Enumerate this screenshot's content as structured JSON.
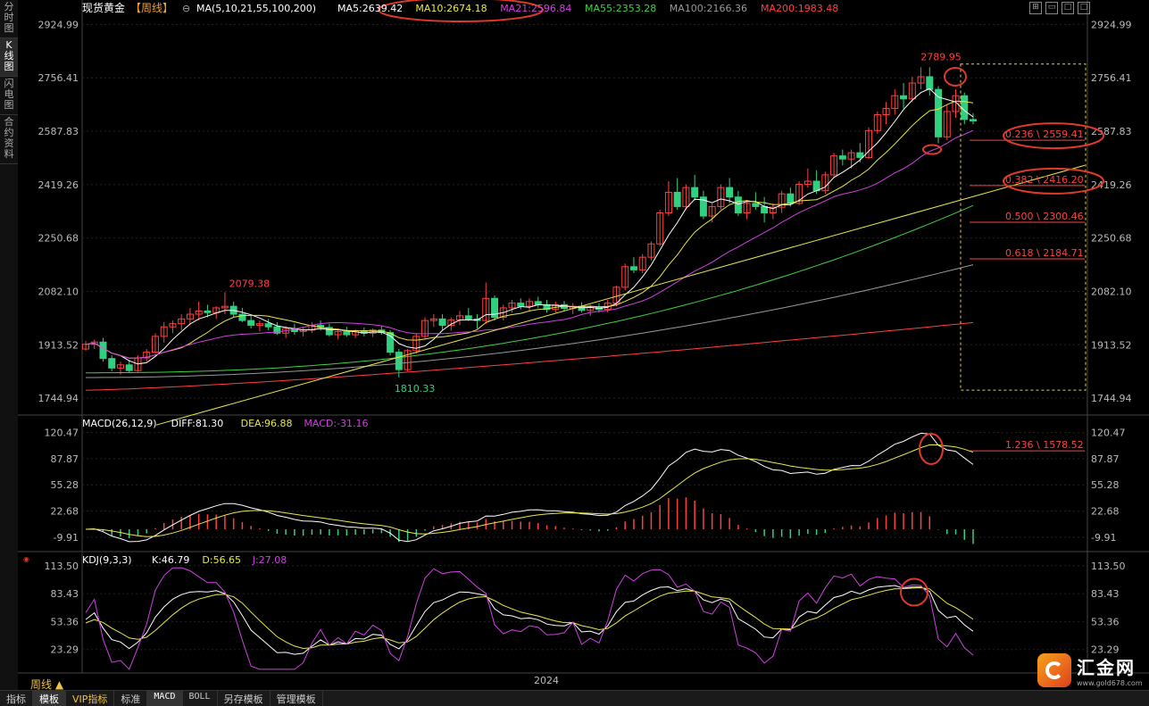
{
  "left_tabs": [
    "分时图",
    "K线图",
    "闪电图",
    "合约资料"
  ],
  "header": {
    "instrument": "现货黄金",
    "period_tag": "【周线】",
    "ma_params": "MA(5,10,21,55,100,200)",
    "ma_values": [
      {
        "label": "MA5:2639.42",
        "color": "#ffffff"
      },
      {
        "label": "MA10:2674.18",
        "color": "#e8e84a"
      },
      {
        "label": "MA21:2596.84",
        "color": "#d040e0"
      },
      {
        "label": "MA55:2353.28",
        "color": "#40d040"
      },
      {
        "label": "MA100:2166.36",
        "color": "#999999"
      },
      {
        "label": "MA200:1983.48",
        "color": "#ff4040"
      }
    ]
  },
  "axis": {
    "main_ticks": [
      "2924.99",
      "2756.41",
      "2587.83",
      "2419.26",
      "2250.68",
      "2082.10",
      "1913.52",
      "1744.94"
    ],
    "macd_ticks": [
      "120.47",
      "87.87",
      "55.28",
      "22.68",
      "-9.91"
    ],
    "kdj_ticks": [
      "113.50",
      "83.43",
      "53.36",
      "23.29"
    ]
  },
  "annotations": {
    "high_label": "2789.95",
    "peak_label": "2079.38",
    "low_label": "1810.33"
  },
  "fib_levels": [
    {
      "label": "0.236 \\ 2559.41",
      "value": 2559.41
    },
    {
      "label": "0.382 \\ 2416.20",
      "value": 2416.2
    },
    {
      "label": "0.500 \\ 2300.46",
      "value": 2300.46
    },
    {
      "label": "0.618 \\ 2184.71",
      "value": 2184.71
    },
    {
      "label": "1.236 \\ 1578.52",
      "value": 1578.52
    }
  ],
  "macd_header": {
    "params": "MACD(26,12,9)",
    "diff": "DIFF:81.30",
    "dea": "DEA:96.88",
    "macd": "MACD:-31.16"
  },
  "kdj_header": {
    "params": "KDJ(9,3,3)",
    "k": "K:46.79",
    "d": "D:56.65",
    "j": "J:27.08"
  },
  "bottom_tabs": [
    "指标",
    "模板",
    "VIP指标",
    "标准",
    "MACD",
    "BOLL",
    "另存模板",
    "管理模板"
  ],
  "period_button": "周线 ▲",
  "year_label": "2024",
  "logo": {
    "name": "汇金网",
    "url": "www.gold678.com"
  },
  "colors": {
    "up": "#ff4040",
    "down": "#30d080",
    "background": "#000000",
    "axis_text": "#bbbbbb",
    "highlight_circle": "#e03a2a",
    "fib_text": "#ff4040"
  },
  "chart_data": {
    "type": "candlestick",
    "period": "weekly",
    "y_range": [
      1700,
      2960
    ],
    "ohlc": [
      [
        1900,
        1925,
        1895,
        1915
      ],
      [
        1915,
        1930,
        1900,
        1922
      ],
      [
        1922,
        1935,
        1860,
        1870
      ],
      [
        1870,
        1880,
        1830,
        1840
      ],
      [
        1840,
        1860,
        1820,
        1850
      ],
      [
        1850,
        1865,
        1825,
        1832
      ],
      [
        1832,
        1880,
        1828,
        1872
      ],
      [
        1872,
        1900,
        1860,
        1890
      ],
      [
        1890,
        1950,
        1885,
        1940
      ],
      [
        1940,
        1985,
        1920,
        1970
      ],
      [
        1970,
        1990,
        1950,
        1980
      ],
      [
        1980,
        2010,
        1960,
        1995
      ],
      [
        1995,
        2030,
        1975,
        2010
      ],
      [
        2010,
        2050,
        1990,
        2020
      ],
      [
        2020,
        2040,
        2000,
        2015
      ],
      [
        2015,
        2035,
        1995,
        2030
      ],
      [
        2030,
        2079.38,
        2010,
        2035
      ],
      [
        2035,
        2050,
        2000,
        2010
      ],
      [
        2010,
        2030,
        1985,
        1990
      ],
      [
        1990,
        2005,
        1965,
        1975
      ],
      [
        1975,
        1990,
        1955,
        1980
      ],
      [
        1980,
        1995,
        1960,
        1970
      ],
      [
        1970,
        1985,
        1945,
        1950
      ],
      [
        1950,
        1972,
        1935,
        1965
      ],
      [
        1965,
        1980,
        1945,
        1955
      ],
      [
        1955,
        1970,
        1940,
        1960
      ],
      [
        1960,
        1985,
        1950,
        1975
      ],
      [
        1975,
        1990,
        1958,
        1968
      ],
      [
        1968,
        1980,
        1940,
        1945
      ],
      [
        1945,
        1965,
        1930,
        1955
      ],
      [
        1955,
        1970,
        1938,
        1945
      ],
      [
        1945,
        1962,
        1935,
        1958
      ],
      [
        1958,
        1968,
        1940,
        1950
      ],
      [
        1950,
        1965,
        1938,
        1960
      ],
      [
        1960,
        1972,
        1945,
        1952
      ],
      [
        1952,
        1960,
        1880,
        1890
      ],
      [
        1890,
        1900,
        1810.33,
        1835
      ],
      [
        1835,
        1900,
        1830,
        1895
      ],
      [
        1895,
        1950,
        1885,
        1940
      ],
      [
        1940,
        2000,
        1930,
        1990
      ],
      [
        1990,
        2010,
        1970,
        1995
      ],
      [
        1995,
        2010,
        1960,
        1975
      ],
      [
        1975,
        2000,
        1958,
        1992
      ],
      [
        1992,
        2020,
        1975,
        2005
      ],
      [
        2005,
        2030,
        1988,
        1995
      ],
      [
        1995,
        2010,
        1965,
        1990
      ],
      [
        1990,
        2110,
        1980,
        2060
      ],
      [
        2060,
        2070,
        1990,
        2000
      ],
      [
        2000,
        2040,
        1990,
        2030
      ],
      [
        2030,
        2055,
        2015,
        2045
      ],
      [
        2045,
        2060,
        2025,
        2035
      ],
      [
        2035,
        2060,
        2020,
        2050
      ],
      [
        2050,
        2065,
        2030,
        2040
      ],
      [
        2040,
        2055,
        2015,
        2025
      ],
      [
        2025,
        2050,
        2015,
        2040
      ],
      [
        2040,
        2052,
        2020,
        2028
      ],
      [
        2028,
        2045,
        2010,
        2035
      ],
      [
        2035,
        2048,
        2015,
        2022
      ],
      [
        2022,
        2040,
        2005,
        2032
      ],
      [
        2032,
        2045,
        2015,
        2025
      ],
      [
        2025,
        2055,
        2015,
        2045
      ],
      [
        2045,
        2100,
        2035,
        2095
      ],
      [
        2095,
        2170,
        2085,
        2160
      ],
      [
        2160,
        2190,
        2140,
        2150
      ],
      [
        2150,
        2200,
        2140,
        2190
      ],
      [
        2190,
        2240,
        2180,
        2232
      ],
      [
        2232,
        2340,
        2225,
        2330
      ],
      [
        2330,
        2430,
        2320,
        2395
      ],
      [
        2395,
        2440,
        2340,
        2350
      ],
      [
        2350,
        2420,
        2340,
        2410
      ],
      [
        2410,
        2450,
        2370,
        2380
      ],
      [
        2380,
        2400,
        2310,
        2320
      ],
      [
        2320,
        2360,
        2300,
        2350
      ],
      [
        2350,
        2420,
        2340,
        2410
      ],
      [
        2410,
        2440,
        2360,
        2380
      ],
      [
        2380,
        2400,
        2320,
        2330
      ],
      [
        2330,
        2370,
        2310,
        2360
      ],
      [
        2360,
        2395,
        2340,
        2350
      ],
      [
        2350,
        2380,
        2300,
        2330
      ],
      [
        2330,
        2360,
        2310,
        2348
      ],
      [
        2348,
        2400,
        2330,
        2390
      ],
      [
        2390,
        2410,
        2350,
        2360
      ],
      [
        2360,
        2430,
        2355,
        2420
      ],
      [
        2420,
        2470,
        2410,
        2430
      ],
      [
        2430,
        2465,
        2390,
        2400
      ],
      [
        2400,
        2460,
        2390,
        2450
      ],
      [
        2450,
        2520,
        2440,
        2510
      ],
      [
        2510,
        2530,
        2480,
        2500
      ],
      [
        2500,
        2530,
        2470,
        2520
      ],
      [
        2520,
        2550,
        2490,
        2505
      ],
      [
        2505,
        2600,
        2500,
        2590
      ],
      [
        2590,
        2650,
        2580,
        2640
      ],
      [
        2640,
        2680,
        2610,
        2660
      ],
      [
        2660,
        2720,
        2640,
        2700
      ],
      [
        2700,
        2740,
        2660,
        2690
      ],
      [
        2690,
        2760,
        2680,
        2740
      ],
      [
        2740,
        2789.95,
        2720,
        2760
      ],
      [
        2760,
        2790,
        2700,
        2720
      ],
      [
        2720,
        2730,
        2550,
        2570
      ],
      [
        2570,
        2670,
        2560,
        2650
      ],
      [
        2650,
        2720,
        2630,
        2700
      ],
      [
        2700,
        2710,
        2610,
        2625
      ],
      [
        2625,
        2645,
        2610,
        2620
      ]
    ],
    "fib_levels": [
      {
        "ratio": 0.236,
        "price": 2559.41
      },
      {
        "ratio": 0.382,
        "price": 2416.2
      },
      {
        "ratio": 0.5,
        "price": 2300.46
      },
      {
        "ratio": 0.618,
        "price": 2184.71
      },
      {
        "ratio": 1.236,
        "price": 1578.52
      }
    ],
    "moving_averages": {
      "MA5": 2639.42,
      "MA10": 2674.18,
      "MA21": 2596.84,
      "MA55": 2353.28,
      "MA100": 2166.36,
      "MA200": 1983.48
    },
    "macd": {
      "DIFF": 81.3,
      "DEA": 96.88,
      "MACD": -31.16,
      "y_range": [
        -20,
        130
      ]
    },
    "kdj": {
      "K": 46.79,
      "D": 56.65,
      "J": 27.08,
      "y_range": [
        0,
        120
      ]
    }
  }
}
